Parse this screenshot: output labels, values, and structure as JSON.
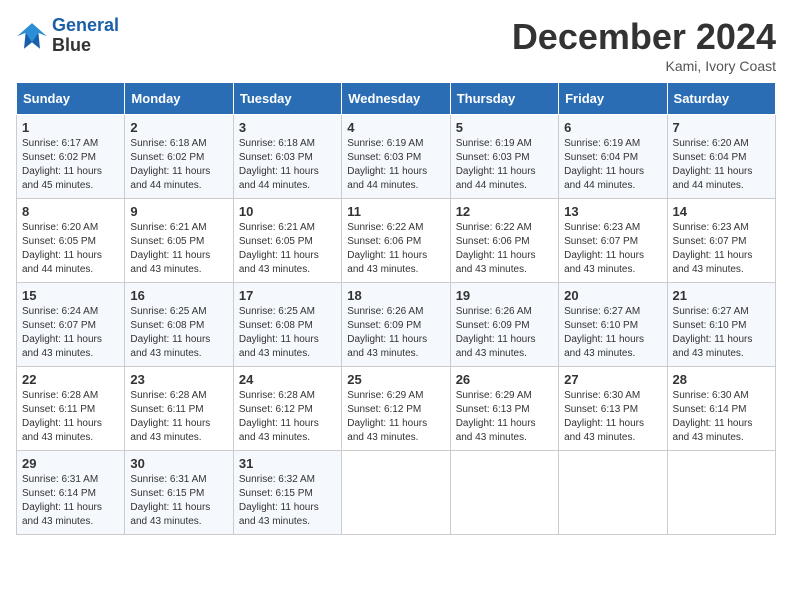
{
  "logo": {
    "line1": "General",
    "line2": "Blue"
  },
  "title": "December 2024",
  "subtitle": "Kami, Ivory Coast",
  "days_of_week": [
    "Sunday",
    "Monday",
    "Tuesday",
    "Wednesday",
    "Thursday",
    "Friday",
    "Saturday"
  ],
  "weeks": [
    [
      {
        "day": "1",
        "info": "Sunrise: 6:17 AM\nSunset: 6:02 PM\nDaylight: 11 hours\nand 45 minutes."
      },
      {
        "day": "2",
        "info": "Sunrise: 6:18 AM\nSunset: 6:02 PM\nDaylight: 11 hours\nand 44 minutes."
      },
      {
        "day": "3",
        "info": "Sunrise: 6:18 AM\nSunset: 6:03 PM\nDaylight: 11 hours\nand 44 minutes."
      },
      {
        "day": "4",
        "info": "Sunrise: 6:19 AM\nSunset: 6:03 PM\nDaylight: 11 hours\nand 44 minutes."
      },
      {
        "day": "5",
        "info": "Sunrise: 6:19 AM\nSunset: 6:03 PM\nDaylight: 11 hours\nand 44 minutes."
      },
      {
        "day": "6",
        "info": "Sunrise: 6:19 AM\nSunset: 6:04 PM\nDaylight: 11 hours\nand 44 minutes."
      },
      {
        "day": "7",
        "info": "Sunrise: 6:20 AM\nSunset: 6:04 PM\nDaylight: 11 hours\nand 44 minutes."
      }
    ],
    [
      {
        "day": "8",
        "info": "Sunrise: 6:20 AM\nSunset: 6:05 PM\nDaylight: 11 hours\nand 44 minutes."
      },
      {
        "day": "9",
        "info": "Sunrise: 6:21 AM\nSunset: 6:05 PM\nDaylight: 11 hours\nand 43 minutes."
      },
      {
        "day": "10",
        "info": "Sunrise: 6:21 AM\nSunset: 6:05 PM\nDaylight: 11 hours\nand 43 minutes."
      },
      {
        "day": "11",
        "info": "Sunrise: 6:22 AM\nSunset: 6:06 PM\nDaylight: 11 hours\nand 43 minutes."
      },
      {
        "day": "12",
        "info": "Sunrise: 6:22 AM\nSunset: 6:06 PM\nDaylight: 11 hours\nand 43 minutes."
      },
      {
        "day": "13",
        "info": "Sunrise: 6:23 AM\nSunset: 6:07 PM\nDaylight: 11 hours\nand 43 minutes."
      },
      {
        "day": "14",
        "info": "Sunrise: 6:23 AM\nSunset: 6:07 PM\nDaylight: 11 hours\nand 43 minutes."
      }
    ],
    [
      {
        "day": "15",
        "info": "Sunrise: 6:24 AM\nSunset: 6:07 PM\nDaylight: 11 hours\nand 43 minutes."
      },
      {
        "day": "16",
        "info": "Sunrise: 6:25 AM\nSunset: 6:08 PM\nDaylight: 11 hours\nand 43 minutes."
      },
      {
        "day": "17",
        "info": "Sunrise: 6:25 AM\nSunset: 6:08 PM\nDaylight: 11 hours\nand 43 minutes."
      },
      {
        "day": "18",
        "info": "Sunrise: 6:26 AM\nSunset: 6:09 PM\nDaylight: 11 hours\nand 43 minutes."
      },
      {
        "day": "19",
        "info": "Sunrise: 6:26 AM\nSunset: 6:09 PM\nDaylight: 11 hours\nand 43 minutes."
      },
      {
        "day": "20",
        "info": "Sunrise: 6:27 AM\nSunset: 6:10 PM\nDaylight: 11 hours\nand 43 minutes."
      },
      {
        "day": "21",
        "info": "Sunrise: 6:27 AM\nSunset: 6:10 PM\nDaylight: 11 hours\nand 43 minutes."
      }
    ],
    [
      {
        "day": "22",
        "info": "Sunrise: 6:28 AM\nSunset: 6:11 PM\nDaylight: 11 hours\nand 43 minutes."
      },
      {
        "day": "23",
        "info": "Sunrise: 6:28 AM\nSunset: 6:11 PM\nDaylight: 11 hours\nand 43 minutes."
      },
      {
        "day": "24",
        "info": "Sunrise: 6:28 AM\nSunset: 6:12 PM\nDaylight: 11 hours\nand 43 minutes."
      },
      {
        "day": "25",
        "info": "Sunrise: 6:29 AM\nSunset: 6:12 PM\nDaylight: 11 hours\nand 43 minutes."
      },
      {
        "day": "26",
        "info": "Sunrise: 6:29 AM\nSunset: 6:13 PM\nDaylight: 11 hours\nand 43 minutes."
      },
      {
        "day": "27",
        "info": "Sunrise: 6:30 AM\nSunset: 6:13 PM\nDaylight: 11 hours\nand 43 minutes."
      },
      {
        "day": "28",
        "info": "Sunrise: 6:30 AM\nSunset: 6:14 PM\nDaylight: 11 hours\nand 43 minutes."
      }
    ],
    [
      {
        "day": "29",
        "info": "Sunrise: 6:31 AM\nSunset: 6:14 PM\nDaylight: 11 hours\nand 43 minutes."
      },
      {
        "day": "30",
        "info": "Sunrise: 6:31 AM\nSunset: 6:15 PM\nDaylight: 11 hours\nand 43 minutes."
      },
      {
        "day": "31",
        "info": "Sunrise: 6:32 AM\nSunset: 6:15 PM\nDaylight: 11 hours\nand 43 minutes."
      },
      null,
      null,
      null,
      null
    ]
  ]
}
